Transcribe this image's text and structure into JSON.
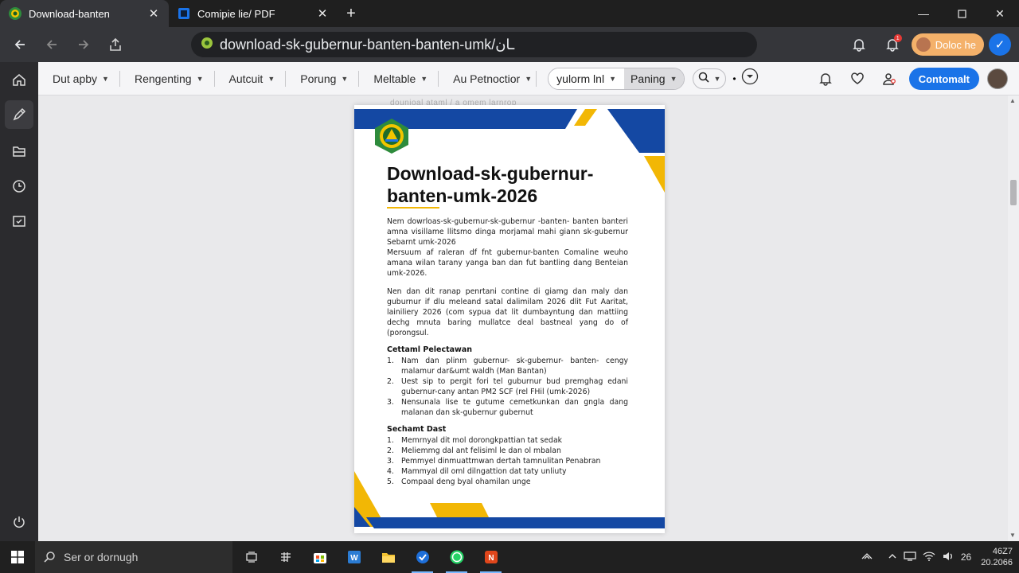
{
  "tabs": [
    {
      "title": "Download-banten",
      "active": true,
      "favicon": "shield-crest-icon"
    },
    {
      "title": "Comipie lie/ PDF",
      "active": false,
      "favicon": "pdf-icon"
    }
  ],
  "address_bar": {
    "url": "download-sk-gubernur-banten-banten-umk/ـان"
  },
  "profile": {
    "name": "Doloc he"
  },
  "notifications": {
    "count": "1"
  },
  "toolbar": {
    "menus": [
      "Dut apby",
      "Rengenting",
      "Autcuit",
      "Porung",
      "Meltable",
      "Au Petnoctior"
    ],
    "view_mode": {
      "left": "yulorm lnl",
      "right": "Paning"
    },
    "continue_label": "Contomalt"
  },
  "ghost_text": "dounioal ataml / a omem larnrop",
  "document": {
    "title": "Download-sk-gubernur-banten-umk-2026",
    "paragraphs": [
      "Nem dowrloas-sk-gubernur-sk-gubernur -banten- banten banteri amna visillame llitsmo dinga morjamal mahi giann sk-gubernur Sebarnt umk-2026",
      "Mersuum af raleran df fnt gubernur-banten Comaline weuho amana wilan tarany yanga ban dan fut bantling dang Benteian umk-2026.",
      "Nen dan dit ranap penrtani contine di giamg dan maly dan guburnur if dlu meleand satal dalimilam 2026 dlit Fut Aaritat, lainiliery 2026 (com sypua dat lit dumbayntung dan mattiing dechg mnuta baring mullatce deal bastneal yang do of (porongsul."
    ],
    "section1": {
      "heading": "Cettaml Pelectawan",
      "items": [
        "Nam dan plinm gubernur- sk-gubernur- banten- cengy malamur dar&umt waldh (Man Bantan)",
        "Uest sip to pergit fori tel guburnur bud premghag edani gubernur-cany antan PM2 SCF (rel FHil (umk-2026)",
        "Nensunala lise te gutume cemetkunkan dan gngla dang malanan dan sk-gubernur gubernut"
      ]
    },
    "section2": {
      "heading": "Sechamt Dast",
      "items": [
        "Memrnyal dit mol dorongkpattian tat sedak",
        "Meliemmg dal ant felisiml le dan ol mbalan",
        "Pemmyel dinmuattmwan dertah tamnulitan Penabran",
        "Mammyal dil oml dilngattion dat taty unliuty",
        "Compaal deng byal ohamilan unge"
      ]
    }
  },
  "taskbar": {
    "search_placeholder": "Ser or dornugh",
    "tray_number": "26",
    "clock_time": "46Z7",
    "clock_date": "20.2066"
  },
  "colors": {
    "brand_blue": "#1448a3",
    "brand_yellow": "#f2b705",
    "accent": "#1a73e8"
  }
}
